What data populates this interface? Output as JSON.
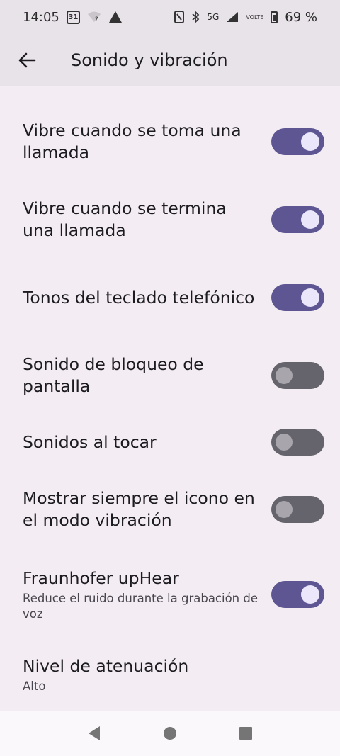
{
  "status_bar": {
    "time": "14:05",
    "calendar_day": "31",
    "network": "5G",
    "volte": "VOLTE",
    "battery": "69 %"
  },
  "app_bar": {
    "title": "Sonido y vibración"
  },
  "settings": [
    {
      "title": "Vibre cuando se toma una llamada",
      "enabled": true
    },
    {
      "title": "Vibre cuando se termina una llamada",
      "enabled": true
    },
    {
      "title": "Tonos del teclado telefónico",
      "enabled": true
    },
    {
      "title": "Sonido de bloqueo de pantalla",
      "enabled": false
    },
    {
      "title": "Sonidos al tocar",
      "enabled": false
    },
    {
      "title": "Mostrar siempre el icono en el modo vibración",
      "enabled": false
    }
  ],
  "uphear": {
    "title": "Fraunhofer upHear",
    "summary": "Reduce el ruido durante la grabación de voz",
    "enabled": true
  },
  "attenuation": {
    "title": "Nivel de atenuación",
    "value": "Alto"
  },
  "colors": {
    "toggle_on": "#5e5693",
    "toggle_off": "#65636b",
    "background": "#f3edf3",
    "app_bar": "#e8e3e9"
  },
  "icons": {
    "back": "arrow-back-icon",
    "nav_back": "triangle-back-icon",
    "nav_home": "circle-home-icon",
    "nav_recents": "square-recents-icon"
  }
}
